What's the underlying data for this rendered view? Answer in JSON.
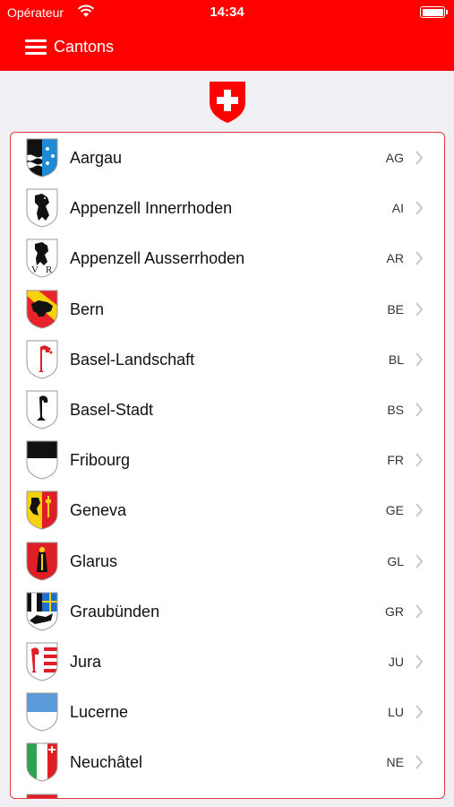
{
  "status": {
    "carrier": "Opérateur",
    "time": "14:34"
  },
  "nav": {
    "title": "Cantons"
  },
  "colors": {
    "brand_red": "#ff0000",
    "list_border": "#e23b3b"
  },
  "cantons": [
    {
      "name": "Aargau",
      "code": "AG"
    },
    {
      "name": "Appenzell Innerrhoden",
      "code": "AI"
    },
    {
      "name": "Appenzell Ausserrhoden",
      "code": "AR"
    },
    {
      "name": "Bern",
      "code": "BE"
    },
    {
      "name": "Basel-Landschaft",
      "code": "BL"
    },
    {
      "name": "Basel-Stadt",
      "code": "BS"
    },
    {
      "name": "Fribourg",
      "code": "FR"
    },
    {
      "name": "Geneva",
      "code": "GE"
    },
    {
      "name": "Glarus",
      "code": "GL"
    },
    {
      "name": "Graubünden",
      "code": "GR"
    },
    {
      "name": "Jura",
      "code": "JU"
    },
    {
      "name": "Lucerne",
      "code": "LU"
    },
    {
      "name": "Neuchâtel",
      "code": "NE"
    }
  ]
}
